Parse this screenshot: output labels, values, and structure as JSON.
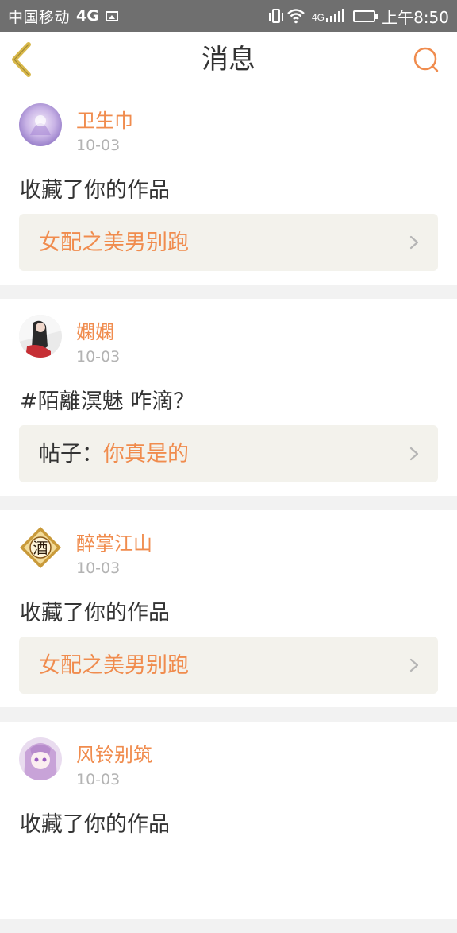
{
  "status_bar": {
    "carrier": "中国移动",
    "network": "4G",
    "network_small": "4G",
    "time": "上午8:50"
  },
  "header": {
    "title": "消息",
    "back_icon": "chevron-left-icon",
    "search_icon": "search-icon"
  },
  "colors": {
    "accent": "#f08c4e",
    "back_icon": "#d8b84a",
    "ref_bg": "#f3f2ec"
  },
  "messages": [
    {
      "username": "卫生巾",
      "date": "10-03",
      "action": "收藏了你的作品",
      "ref_prefix": "",
      "ref_title": "女配之美男别跑"
    },
    {
      "username": "嫻嫻",
      "date": "10-03",
      "action": "#陌離溟魅 咋滴？",
      "ref_prefix": "帖子：",
      "ref_title": "你真是的"
    },
    {
      "username": "醉掌江山",
      "date": "10-03",
      "action": "收藏了你的作品",
      "ref_prefix": "",
      "ref_title": "女配之美男别跑",
      "avatar_glyph": "酒"
    },
    {
      "username": "风铃别筑",
      "date": "10-03",
      "action": "收藏了你的作品",
      "ref_prefix": "",
      "ref_title": ""
    }
  ]
}
